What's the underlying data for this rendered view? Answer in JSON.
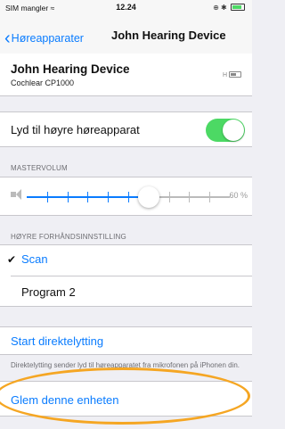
{
  "status_bar": {
    "carrier": "SIM mangler ≈",
    "time": "12.24",
    "indicators": "⊕ ✱"
  },
  "nav": {
    "back_label": "Høreapparater",
    "title": "John Hearing Device"
  },
  "device": {
    "name": "John Hearing Device",
    "model": "Cochlear CP1000",
    "side_indicator": "H"
  },
  "audio_toggle": {
    "label": "Lyd til høyre høreapparat",
    "on": true,
    "accent_color": "#4cd964"
  },
  "master_volume": {
    "header": "MASTERVOLUM",
    "value_percent": 60,
    "percent_label": "60 %",
    "accent_color": "#0a7cff"
  },
  "preset": {
    "header": "HØYRE FORHÅNDSINNSTILLING",
    "items": [
      {
        "label": "Scan",
        "selected": true
      },
      {
        "label": "Program 2",
        "selected": false
      }
    ]
  },
  "streaming": {
    "start_label": "Start direktelytting",
    "footnote": "Direktelytting sender lyd til høreapparatet fra mikrofonen på iPhonen din."
  },
  "forget": {
    "label": "Glem denne enheten",
    "highlight_color": "#f5a623"
  }
}
